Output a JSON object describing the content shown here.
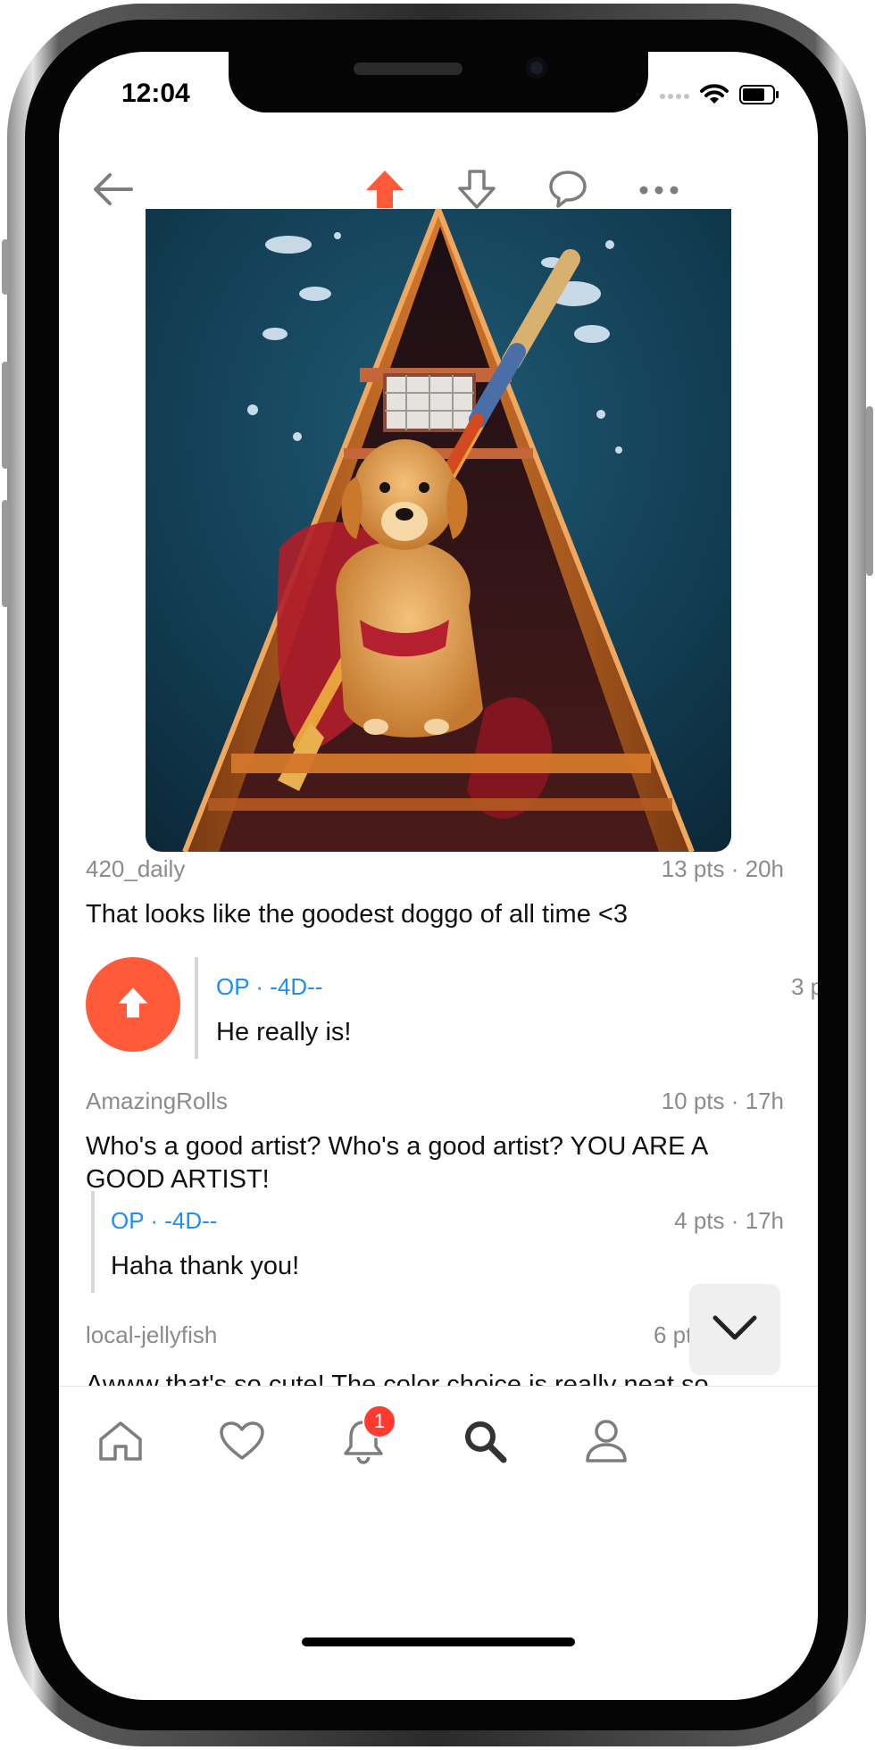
{
  "status": {
    "time": "12:04"
  },
  "nav": {
    "back_icon": "arrow-left-icon",
    "upvote_icon": "arrow-up-icon",
    "downvote_icon": "arrow-down-icon",
    "comment_icon": "speech-bubble-icon",
    "more_icon": "ellipsis-icon"
  },
  "colors": {
    "accent": "#ff5a3a",
    "op_blue": "#1e8ef7",
    "meta_gray": "#8b8b8b"
  },
  "post": {
    "image_icon": "dog-in-canoe-painting"
  },
  "comments": [
    {
      "author": "420_daily",
      "meta": "13 pts · 20h",
      "text": "That looks like the goodest doggo of all time <3",
      "reply": {
        "tag": "OP ·  -4D--",
        "meta": "3 p",
        "text": "He really is!"
      }
    },
    {
      "author": "AmazingRolls",
      "meta": "10 pts · 17h",
      "text": "Who's a good artist? Who's a good artist? YOU ARE A GOOD ARTIST!",
      "reply": {
        "tag": "OP ·  -4D--",
        "meta": "4 pts · 17h",
        "text": "Haha thank you!"
      }
    },
    {
      "author": "local-jellyfish",
      "meta": "6 pt",
      "text": "Awww that's so cute! The color choice is really neat so"
    }
  ],
  "tabbar": {
    "items": [
      {
        "icon": "home-icon"
      },
      {
        "icon": "heart-icon"
      },
      {
        "icon": "bell-icon",
        "badge": "1"
      },
      {
        "icon": "search-icon"
      },
      {
        "icon": "profile-icon"
      }
    ]
  }
}
